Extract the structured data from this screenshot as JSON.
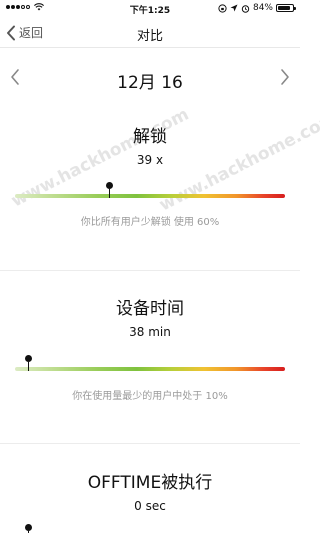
{
  "status_bar": {
    "time": "下午1:25",
    "battery": "84%"
  },
  "nav": {
    "back_label": "返回",
    "title": "对比"
  },
  "date": {
    "label": "12月 16"
  },
  "sections": [
    {
      "title": "解锁",
      "value": "39 x",
      "marker_fraction": 0.35,
      "caption": "你比所有用户少解锁 使用 60%"
    },
    {
      "title": "设备时间",
      "value": "38 min",
      "marker_fraction": 0.05,
      "caption": "你在使用量最少的用户中处于 10%"
    },
    {
      "title": "OFFTIME被执行",
      "value": "0 sec",
      "marker_fraction": 0.05
    }
  ],
  "watermark": "www.hackhome.com",
  "icons": {
    "back": "chevron-left-icon",
    "prev": "chevron-left-icon",
    "next": "chevron-right-icon",
    "lock_rotation": "lock-rotation-icon",
    "location": "location-arrow-icon",
    "alarm": "alarm-icon"
  }
}
